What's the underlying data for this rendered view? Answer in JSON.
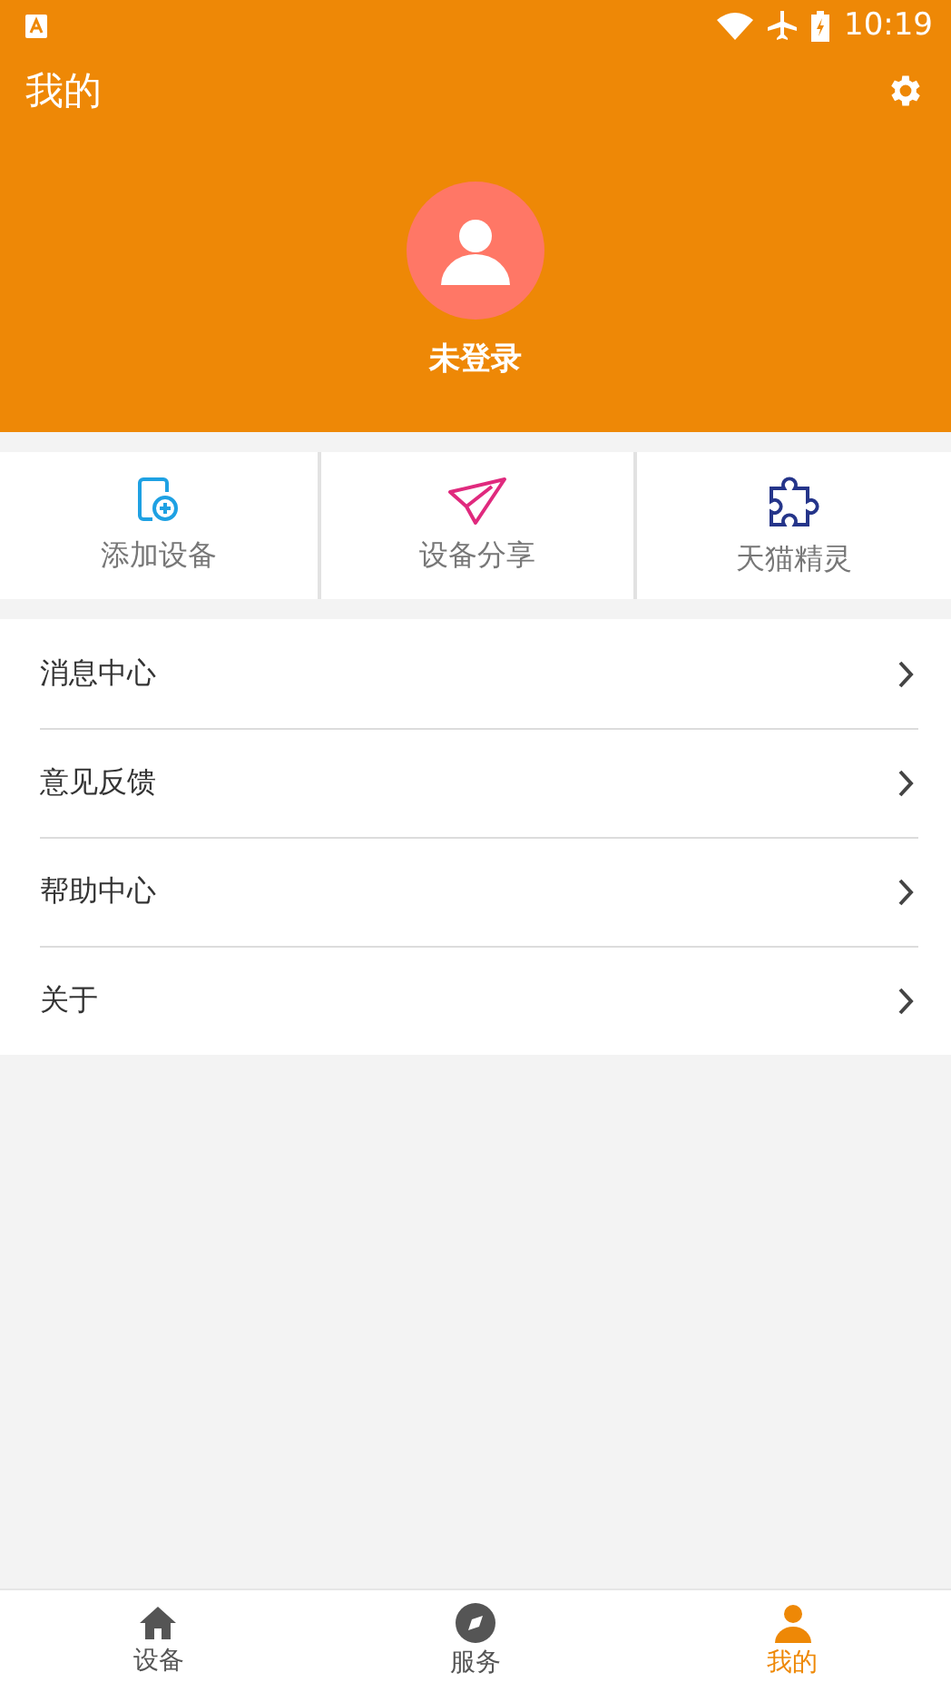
{
  "status_bar": {
    "time": "10:19"
  },
  "header": {
    "title": "我的",
    "user_name": "未登录"
  },
  "quick_actions": [
    {
      "kind": "add",
      "label": "添加设备"
    },
    {
      "kind": "share",
      "label": "设备分享"
    },
    {
      "kind": "puzzle",
      "label": "天猫精灵"
    }
  ],
  "menu": [
    {
      "label": "消息中心"
    },
    {
      "label": "意见反馈"
    },
    {
      "label": "帮助中心"
    },
    {
      "label": "关于"
    }
  ],
  "tabs": [
    {
      "kind": "home",
      "label": "设备",
      "selected": false
    },
    {
      "kind": "compass",
      "label": "服务",
      "selected": false
    },
    {
      "kind": "person",
      "label": "我的",
      "selected": true
    }
  ]
}
